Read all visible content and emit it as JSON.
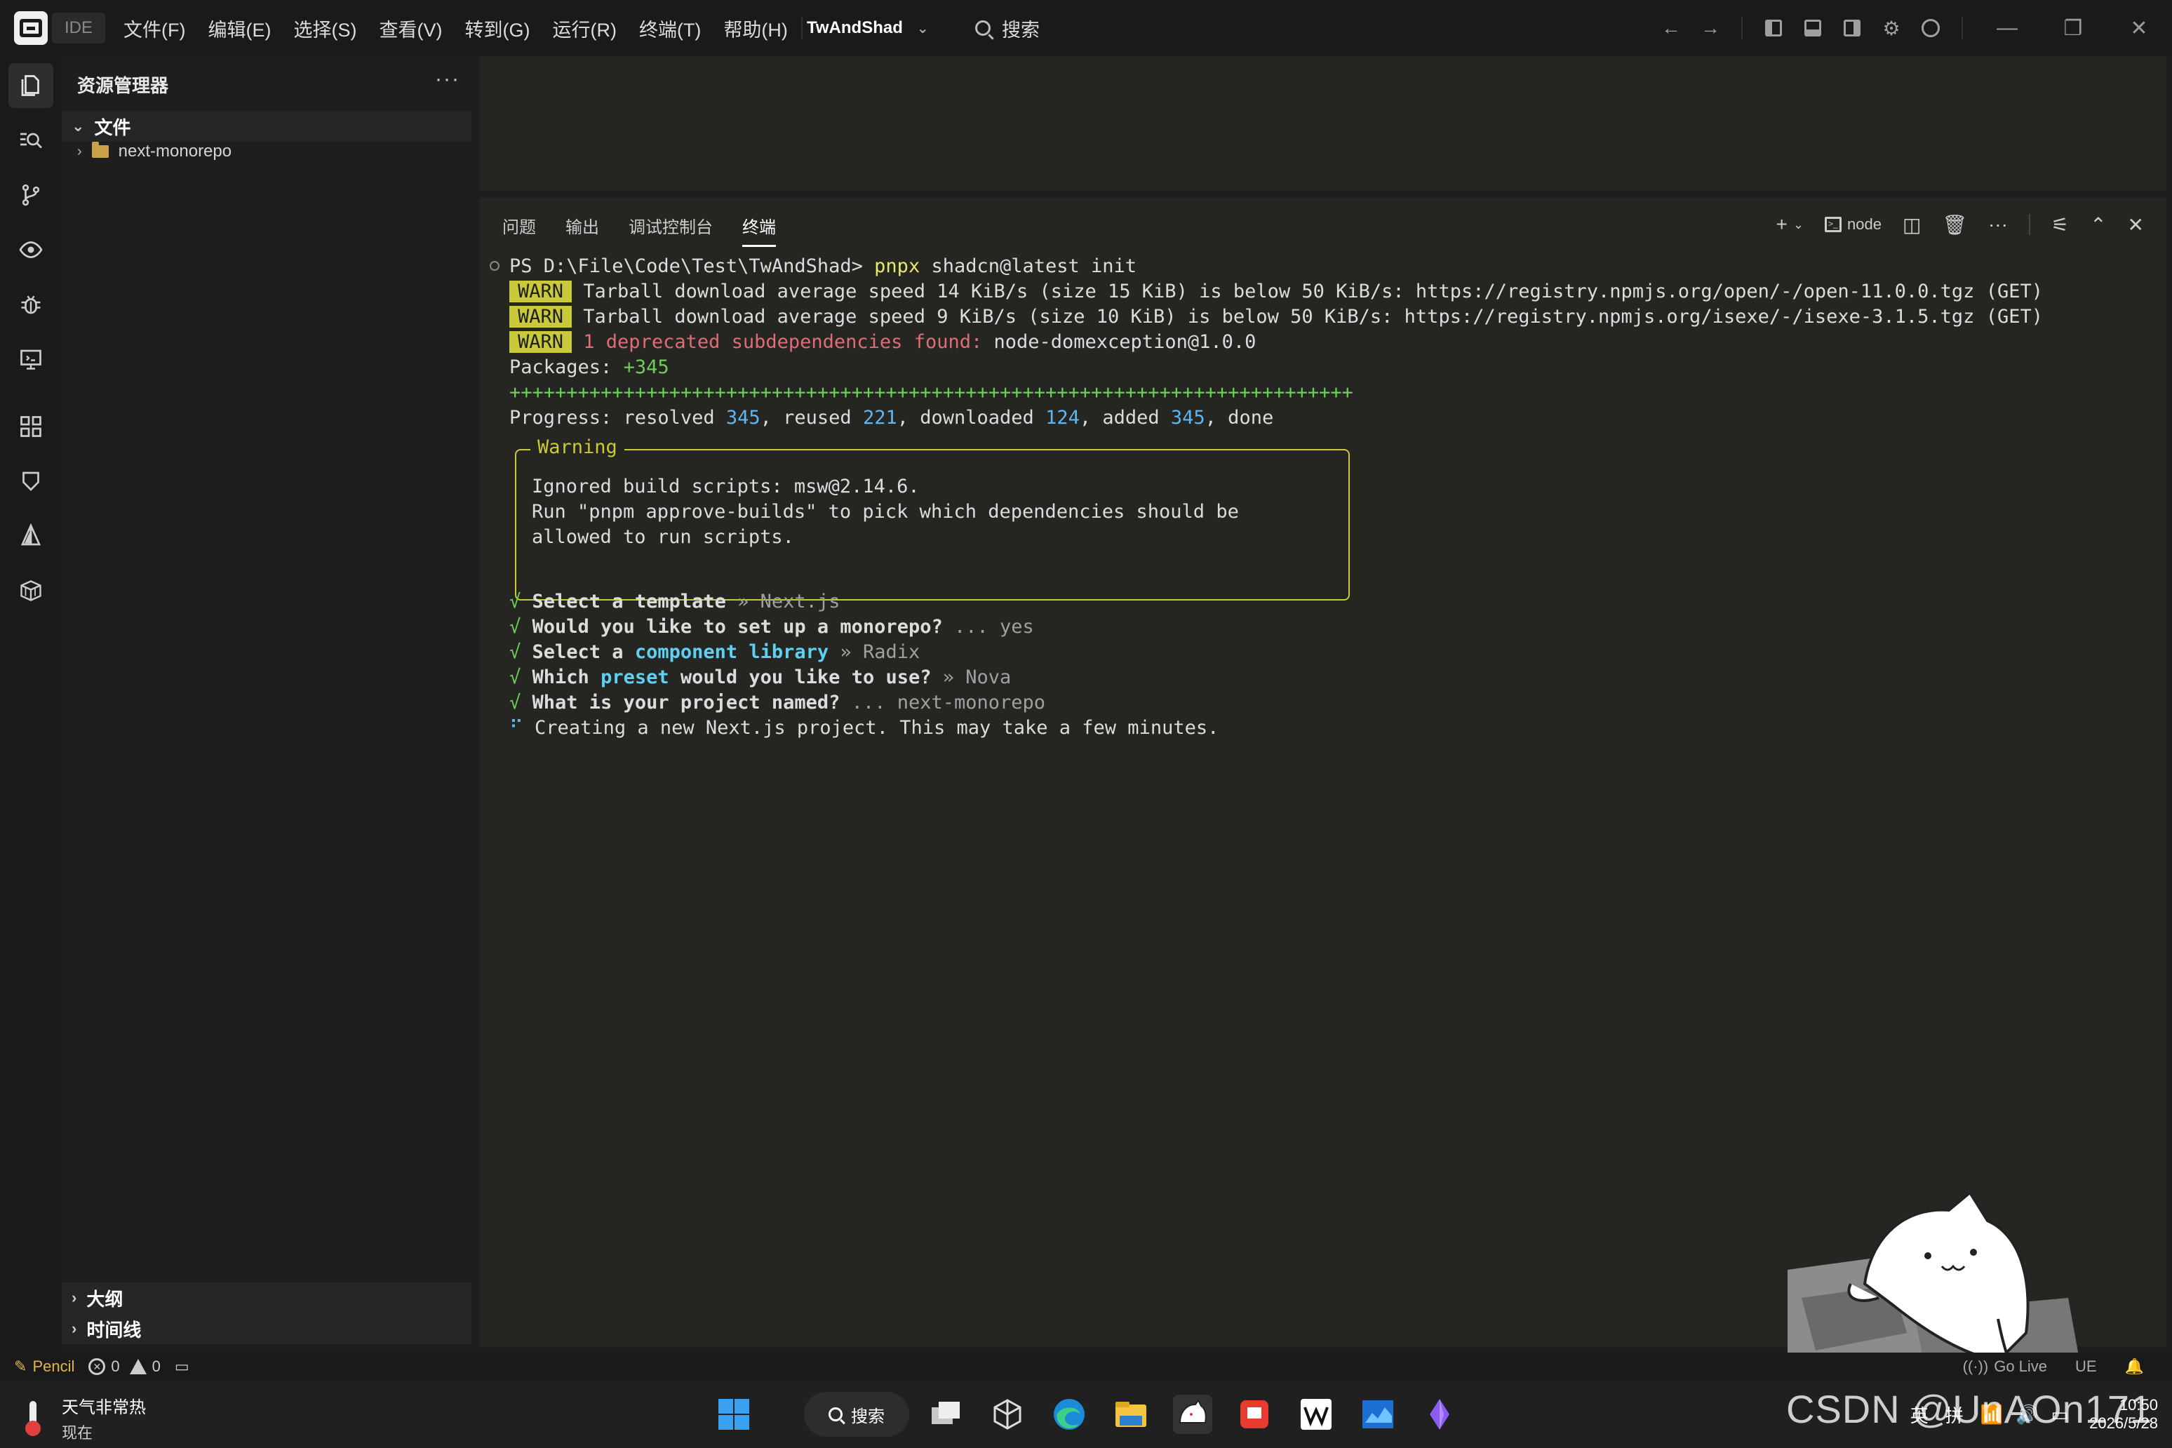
{
  "titlebar": {
    "ide_badge": "IDE",
    "menu": [
      "文件(F)",
      "编辑(E)",
      "选择(S)",
      "查看(V)",
      "转到(G)",
      "运行(R)",
      "终端(T)",
      "帮助(H)"
    ],
    "project": "TwAndShad",
    "search": "搜索"
  },
  "sidebar": {
    "title": "资源管理器",
    "more": "···",
    "files_section": "文件",
    "tree_item": "next-monorepo",
    "outline_section": "大纲",
    "timeline_section": "时间线"
  },
  "panel": {
    "tabs": [
      "问题",
      "输出",
      "调试控制台",
      "终端"
    ],
    "active_tab": "终端",
    "terminal_profile": "node"
  },
  "terminal": {
    "prompt": "PS D:\\File\\Code\\Test\\TwAndShad> ",
    "cmd_pnpx": "pnpx",
    "cmd_rest": " shadcn@latest init",
    "warn_label": "WARN",
    "warn1": " Tarball download average speed 14 KiB/s (size 15 KiB) is below 50 KiB/s: https://registry.npmjs.org/open/-/open-11.0.0.tgz (GET)",
    "warn2": " Tarball download average speed 9 KiB/s (size 10 KiB) is below 50 KiB/s: https://registry.npmjs.org/isexe/-/isexe-3.1.5.tgz (GET)",
    "warn3_red": " 1 deprecated subdependencies found:",
    "warn3_rest": " node-domexception@1.0.0",
    "packages_label": "Packages: ",
    "packages_value": "+345",
    "progress_bar": "++++++++++++++++++++++++++++++++++++++++++++++++++++++++++++++++++++++++++",
    "progress_prefix": "Progress: resolved ",
    "resolved": "345",
    "reused_label": ", reused ",
    "reused": "221",
    "downloaded_label": ", downloaded ",
    "downloaded": "124",
    "added_label": ", added ",
    "added": "345",
    "done": ", done",
    "warning_title": "Warning",
    "warning_l1": "Ignored build scripts: msw@2.14.6.",
    "warning_l2": "Run \"pnpm approve-builds\" to pick which dependencies should be",
    "warning_l3": "allowed to run scripts.",
    "q1": "Select a template",
    "a1": " » Next.js",
    "q2": "Would you like to set up a monorepo?",
    "a2": " ... yes",
    "q3a": "Select a ",
    "q3b": "component library",
    "a3": " » Radix",
    "q4a": "Which ",
    "q4b": "preset",
    "q4c": " would you like to use?",
    "a4": " » Nova",
    "q5": "What is your project named?",
    "a5": " ... next-monorepo",
    "creating": "Creating a new Next.js project. This may take a few minutes.",
    "check": "√ ",
    "spinner": "⠋ "
  },
  "statusbar": {
    "pencil": "Pencil",
    "errors": "0",
    "warnings": "0",
    "golive": "Go Live",
    "encoding": "UE"
  },
  "taskbar": {
    "weather_title": "天气非常热",
    "weather_sub": "现在",
    "search": "搜索",
    "ime1": "英",
    "ime2": "拼",
    "time": "10:50",
    "date": "2026/5/28"
  },
  "watermark": "CSDN @UnAOn171",
  "colors": {
    "warn_bg": "#c9c93a",
    "cmd": "#e6e66b",
    "green": "#6dcf5a",
    "blue": "#5fb6f0",
    "red": "#e06c75"
  }
}
